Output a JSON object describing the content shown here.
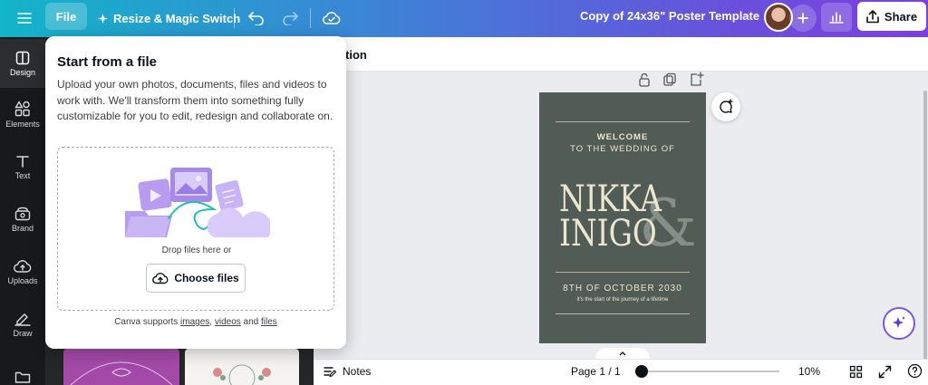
{
  "topbar": {
    "file_label": "File",
    "resize_label": "Resize & Magic Switch",
    "doc_title": "Copy of 24x36\" Poster Template",
    "share_label": "Share"
  },
  "rail": {
    "items": [
      {
        "label": "Design",
        "icon": "design-icon"
      },
      {
        "label": "Elements",
        "icon": "elements-icon"
      },
      {
        "label": "Text",
        "icon": "text-icon"
      },
      {
        "label": "Brand",
        "icon": "brand-icon"
      },
      {
        "label": "Uploads",
        "icon": "uploads-icon"
      },
      {
        "label": "Draw",
        "icon": "draw-icon"
      },
      {
        "label": "",
        "icon": "projects-icon"
      }
    ]
  },
  "context_bar": {
    "partial_label": "tion"
  },
  "popup": {
    "title": "Start from a file",
    "description": "Upload your own photos, documents, files and videos to work with. We'll transform them into something fully customizable for you to edit, redesign and collaborate on.",
    "drop_text": "Drop files here or",
    "choose_label": "Choose files",
    "supports_prefix": "Canva supports ",
    "supports_images": "images",
    "supports_sep": ", ",
    "supports_videos": "videos",
    "supports_and": " and ",
    "supports_files": "files"
  },
  "poster": {
    "welcome": "WELCOME",
    "to_wedding": "TO THE WEDDING OF",
    "name1": "NIKKA",
    "name2": "INIGO",
    "ampersand": "&",
    "date": "8TH OF OCTOBER 2030",
    "tagline": "it's the start of the journey of a lifetime",
    "bg_color": "#515c56"
  },
  "bottombar": {
    "notes_label": "Notes",
    "page_label": "Page 1 / 1",
    "zoom_label": "10%",
    "zoom_fraction": 0.0
  },
  "colors": {
    "topbar_start": "#12b5c9",
    "topbar_end": "#7d3fe0",
    "rail_bg": "#18191b",
    "accent": "#7b55e6"
  }
}
